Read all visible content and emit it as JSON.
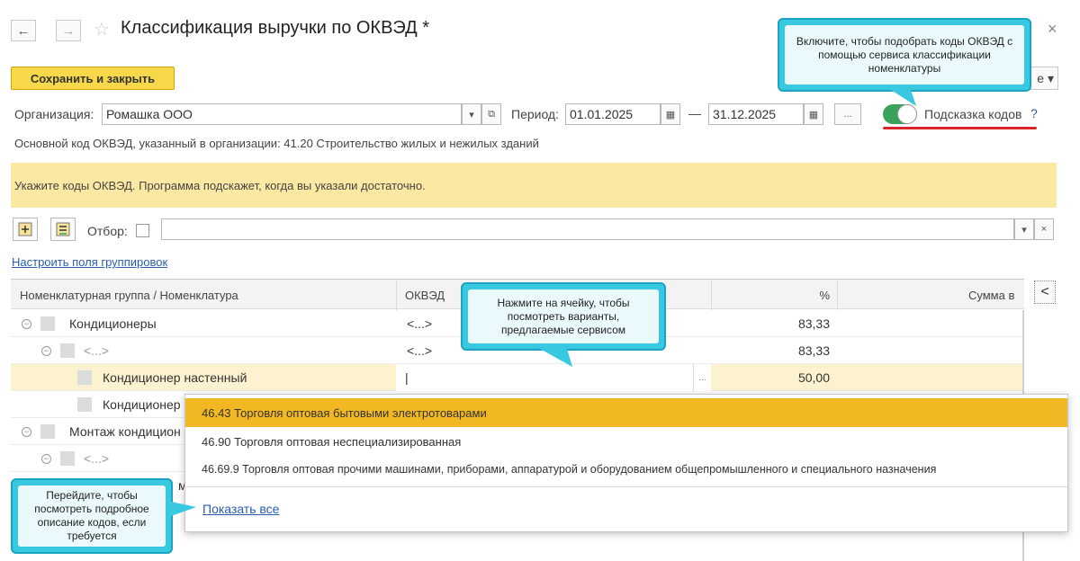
{
  "window": {
    "title": "Классификация выручки по ОКВЭД *",
    "back_glyph": "←",
    "forward_glyph": "→",
    "star_glyph": "☆",
    "close_glyph": "×"
  },
  "toolbar": {
    "save_close_label": "Сохранить и закрыть",
    "more_label": "е ▾"
  },
  "filters": {
    "org_label": "Организация:",
    "org_value": "Ромашка ООО",
    "period_label": "Период:",
    "period_from": "01.01.2025",
    "period_to": "31.12.2025",
    "period_dash": "—",
    "ellipsis": "...",
    "hint_toggle_label": "Подсказка кодов",
    "hint_toggle_on": true,
    "help_glyph": "?"
  },
  "main_code_text": "Основной код ОКВЭД, указанный в организации: 41.20 Строительство жилых и нежилых зданий",
  "info_banner": "Укажите коды ОКВЭД. Программа подскажет, когда вы указали достаточно.",
  "filter_bar": {
    "filter_label": "Отбор:",
    "clear_glyph": "×",
    "dropdown_glyph": "▾"
  },
  "grouping_link": "Настроить поля группировок",
  "table": {
    "headers": [
      "Номенклатурная группа / Номенклатура",
      "ОКВЭД",
      "%",
      "Сумма в"
    ],
    "collapse_glyph": "<",
    "rows": [
      {
        "name": "Кондиционеры",
        "okved": "<...>",
        "pct": "83,33"
      },
      {
        "name": "<...>",
        "okved": "<...>",
        "pct": "83,33"
      },
      {
        "name": "Кондиционер настенный",
        "okved": "|",
        "pct": "50,00"
      },
      {
        "name": "Кондиционер",
        "okved": "",
        "pct": ""
      },
      {
        "name": "Монтаж кондицион",
        "okved": "",
        "pct": ""
      },
      {
        "name": "<...>",
        "okved": "",
        "pct": ""
      },
      {
        "name": "м",
        "okved": "",
        "pct": ""
      }
    ]
  },
  "dropdown": {
    "items": [
      "46.43 Торговля оптовая бытовыми электротоварами",
      "46.90 Торговля оптовая неспециализированная",
      "46.69.9 Торговля оптовая прочими машинами, приборами, аппаратурой и оборудованием общепромышленного и специального назначения"
    ],
    "show_all_link": "Показать все"
  },
  "tooltips": {
    "toggle_tip": "Включите, чтобы подобрать коды ОКВЭД с помощью сервиса классификации номенклатуры",
    "cell_tip": "Нажмите на ячейку, чтобы посмотреть варианты, предлагаемые сервисом",
    "link_tip": "Перейдите, чтобы посмотреть подробное описание кодов, если требуется"
  },
  "colors": {
    "accent_yellow": "#f7d84a",
    "highlight_row": "#fdf2cf",
    "dropdown_selected": "#f2b824",
    "toggle_green": "#3aa35b",
    "tooltip_border": "#38c9e0",
    "red_underline": "#d9262b",
    "link_blue": "#2a5db0"
  }
}
